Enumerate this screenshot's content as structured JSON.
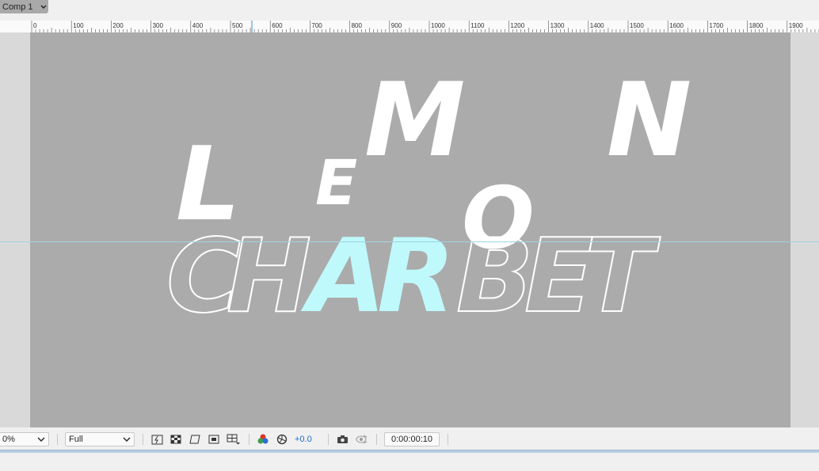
{
  "comp_tab": {
    "label": "Comp 1"
  },
  "ruler": {
    "labels": [
      "0",
      "100",
      "200",
      "300",
      "400",
      "500",
      "600",
      "700",
      "800",
      "900",
      "1000",
      "1100",
      "1200",
      "1300",
      "1400",
      "1500",
      "1600",
      "1700",
      "1800",
      "1900"
    ]
  },
  "canvas": {
    "background": "#ababab",
    "top_letters": [
      "L",
      "E",
      "M",
      "O",
      "N"
    ],
    "bottom_letters": [
      "C",
      "H",
      "A",
      "R",
      "B",
      "E",
      "T"
    ],
    "fill_color": "#ffffff",
    "highlight_color": "#bff9fb"
  },
  "toolbar": {
    "magnification": "0%",
    "resolution": "Full",
    "exposure": "+0.0",
    "timecode": "0:00:00:10"
  }
}
